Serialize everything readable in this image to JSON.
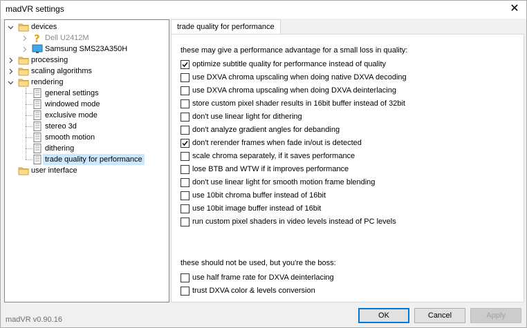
{
  "window": {
    "title": "madVR settings"
  },
  "tree": {
    "items": [
      {
        "label": "devices",
        "icon": "folder-open-icon",
        "expanded": true
      },
      {
        "label": "Dell U2412M",
        "icon": "question-icon",
        "disabled": true
      },
      {
        "label": "Samsung SMS23A350H",
        "icon": "monitor-icon"
      },
      {
        "label": "processing",
        "icon": "folder-icon"
      },
      {
        "label": "scaling algorithms",
        "icon": "folder-icon"
      },
      {
        "label": "rendering",
        "icon": "folder-open-icon",
        "expanded": true
      },
      {
        "label": "general settings",
        "icon": "notebook-icon"
      },
      {
        "label": "windowed mode",
        "icon": "notebook-icon"
      },
      {
        "label": "exclusive mode",
        "icon": "notebook-icon"
      },
      {
        "label": "stereo 3d",
        "icon": "notebook-icon"
      },
      {
        "label": "smooth motion",
        "icon": "notebook-icon"
      },
      {
        "label": "dithering",
        "icon": "notebook-icon"
      },
      {
        "label": "trade quality for performance",
        "icon": "notebook-icon",
        "selected": true
      },
      {
        "label": "user interface",
        "icon": "folder-icon"
      }
    ]
  },
  "tab": {
    "label": "trade quality for performance"
  },
  "sections": {
    "performance_intro": "these may give a performance advantage for a small loss in quality:",
    "boss_intro": "these should not be used, but you're the boss:"
  },
  "options": [
    {
      "label": "optimize subtitle quality for performance instead of quality",
      "checked": true
    },
    {
      "label": "use DXVA chroma upscaling when doing native DXVA decoding",
      "checked": false
    },
    {
      "label": "use DXVA chroma upscaling when doing DXVA deinterlacing",
      "checked": false
    },
    {
      "label": "store custom pixel shader results in 16bit buffer instead of 32bit",
      "checked": false
    },
    {
      "label": "don't use linear light for dithering",
      "checked": false
    },
    {
      "label": "don't analyze gradient angles for debanding",
      "checked": false
    },
    {
      "label": "don't rerender frames when fade in/out is detected",
      "checked": true
    },
    {
      "label": "scale chroma separately, if it saves performance",
      "checked": false
    },
    {
      "label": "lose BTB and WTW if it improves performance",
      "checked": false
    },
    {
      "label": "don't use linear light for smooth motion frame blending",
      "checked": false
    },
    {
      "label": "use 10bit chroma buffer instead of 16bit",
      "checked": false
    },
    {
      "label": "use 10bit image buffer instead of 16bit",
      "checked": false
    },
    {
      "label": "run custom pixel shaders in video levels instead of PC levels",
      "checked": false
    }
  ],
  "boss_options": [
    {
      "label": "use half frame rate for DXVA deinterlacing",
      "checked": false
    },
    {
      "label": "trust DXVA color & levels conversion",
      "checked": false
    }
  ],
  "footer": {
    "version": "madVR v0.90.16",
    "ok_label": "OK",
    "cancel_label": "Cancel",
    "apply_label": "Apply"
  },
  "colors": {
    "selection": "#cce8ff",
    "accent": "#0078d7",
    "folder": "#f5d27a"
  }
}
